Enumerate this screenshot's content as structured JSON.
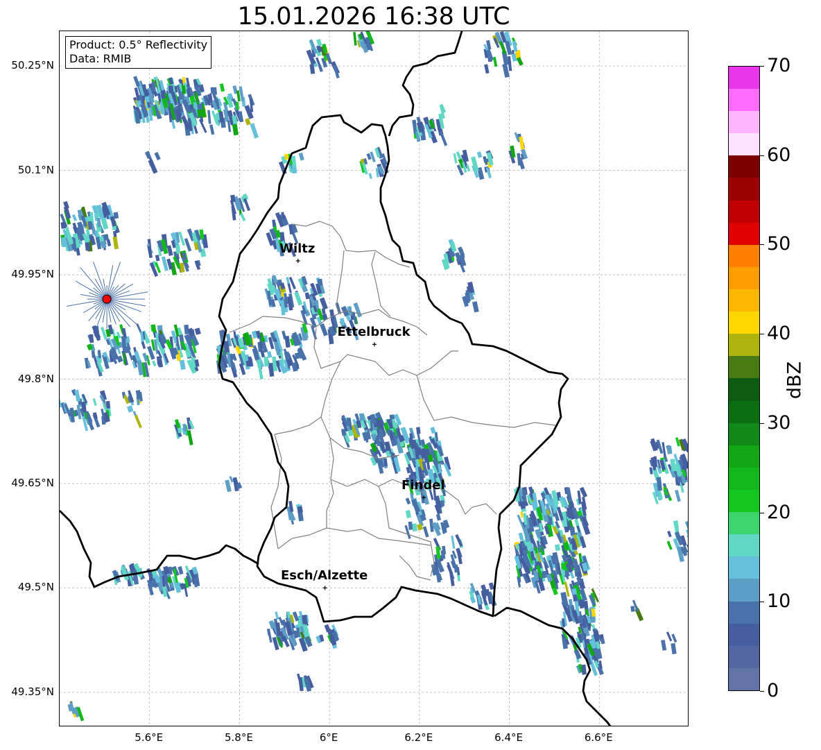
{
  "title": "15.01.2026 16:38 UTC",
  "product_box": {
    "line1": "Product: 0.5° Reflectivity",
    "line2": "Data: RMIB"
  },
  "axes": {
    "lon_range": [
      5.4,
      6.8
    ],
    "lat_range": [
      49.3,
      50.3
    ],
    "lat_ticks": [
      50.25,
      50.1,
      49.95,
      49.8,
      49.65,
      49.5,
      49.35
    ],
    "lat_tick_labels": [
      "50.25°N",
      "50.1°N",
      "49.95°N",
      "49.8°N",
      "49.65°N",
      "49.5°N",
      "49.35°N"
    ],
    "lon_ticks": [
      5.6,
      5.8,
      6.0,
      6.2,
      6.4,
      6.6
    ],
    "lon_tick_labels": [
      "5.6°E",
      "5.8°E",
      "6°E",
      "6.2°E",
      "6.4°E",
      "6.6°E"
    ],
    "grid": true
  },
  "cities": [
    {
      "name": "Wiltz",
      "lon": 5.93,
      "lat": 49.97
    },
    {
      "name": "Ettelbruck",
      "lon": 6.1,
      "lat": 49.85
    },
    {
      "name": "Findel",
      "lon": 6.21,
      "lat": 49.63
    },
    {
      "name": "Esch/Alzette",
      "lon": 5.99,
      "lat": 49.5
    }
  ],
  "radar_site": {
    "lon": 5.505,
    "lat": 49.915,
    "color": "#ff0000"
  },
  "colorbar": {
    "label": "dBZ",
    "min": 0,
    "max": 70,
    "ticks": [
      0,
      10,
      20,
      30,
      40,
      50,
      60,
      70
    ],
    "tick_labels": [
      "0",
      "10",
      "20",
      "30",
      "40",
      "50",
      "60",
      "70"
    ],
    "colors": [
      "#6273a7",
      "#5567a2",
      "#455ea0",
      "#4a72aa",
      "#5d9ec6",
      "#64c0db",
      "#61d8c5",
      "#3dd46e",
      "#14c71f",
      "#12b81b",
      "#13a614",
      "#11891a",
      "#0b6f12",
      "#0b5b11",
      "#467b13",
      "#aeb40b",
      "#fed700",
      "#fdb701",
      "#ff9e00",
      "#ff7f00",
      "#e00101",
      "#c00000",
      "#9b0101",
      "#7b0000",
      "#ffe1ff",
      "#ffb4ff",
      "#ff6cff",
      "#ea36ea"
    ]
  },
  "colors": {
    "border_country": "#000000",
    "border_canton": "#808080",
    "grid": "#b4b4b4"
  }
}
